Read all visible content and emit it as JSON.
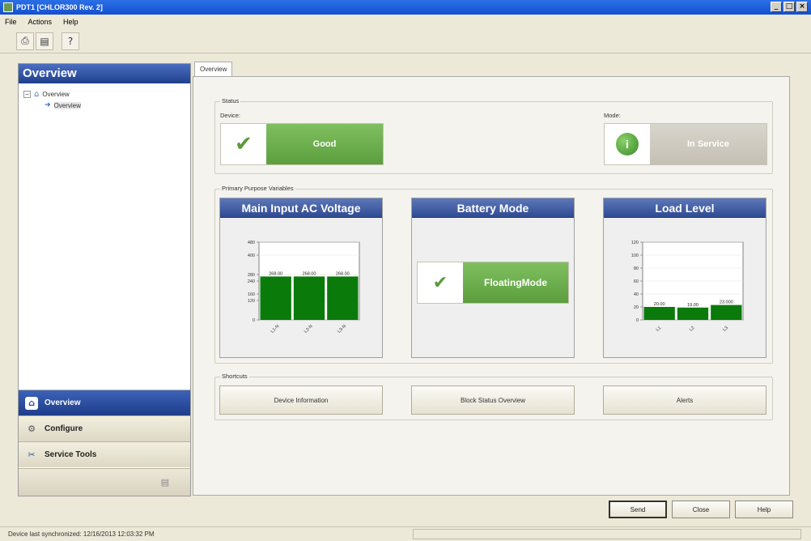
{
  "window": {
    "title": "PDT1 [CHLOR300 Rev. 2]",
    "min": "_",
    "max": "□",
    "close": "×"
  },
  "menu": [
    "File",
    "Actions",
    "Help"
  ],
  "toolbar": {
    "print_icon": "printer-icon",
    "preview_icon": "print-preview-icon",
    "help_icon": "context-help-icon"
  },
  "left": {
    "header": "Overview",
    "tree": {
      "root": "Overview",
      "child": "Overview"
    },
    "nav": [
      {
        "label": "Overview",
        "active": true
      },
      {
        "label": "Configure",
        "active": false
      },
      {
        "label": "Service Tools",
        "active": false
      }
    ]
  },
  "tab": "Overview",
  "status": {
    "group": "Status",
    "device_label": "Device:",
    "device_value": "Good",
    "mode_label": "Mode:",
    "mode_value": "In Service"
  },
  "pv": {
    "group": "Primary Purpose Variables",
    "main_input": {
      "title": "Main Input AC Voltage",
      "chart_data": {
        "type": "bar",
        "categories": [
          "L1-N",
          "L2-N",
          "L3-N"
        ],
        "values": [
          268.0,
          268.0,
          268.0
        ],
        "data_labels": [
          "268.00",
          "268.00",
          "268.00"
        ],
        "yticks": [
          0,
          120,
          160,
          240,
          280,
          400,
          480
        ],
        "ylim": [
          0,
          480
        ],
        "color": "#0a7a0a"
      }
    },
    "battery": {
      "title": "Battery Mode",
      "value_line1": "Floating",
      "value_line2": "Mode"
    },
    "load": {
      "title": "Load Level",
      "chart_data": {
        "type": "bar",
        "categories": [
          "L1",
          "L2",
          "L3"
        ],
        "values": [
          20.0,
          19.0,
          23.0
        ],
        "data_labels": [
          "20.00",
          "19.00",
          "23.000"
        ],
        "yticks": [
          0,
          20,
          40,
          60,
          80,
          100,
          120
        ],
        "ylim": [
          0,
          120
        ],
        "color": "#0a7a0a"
      }
    }
  },
  "shortcuts": {
    "group": "Shortcuts",
    "items": [
      "Device Information",
      "Block Status Overview",
      "Alerts"
    ]
  },
  "buttons": {
    "send": "Send",
    "close": "Close",
    "help": "Help"
  },
  "statusbar": "Device last synchronized: 12/16/2013 12:03:32 PM"
}
